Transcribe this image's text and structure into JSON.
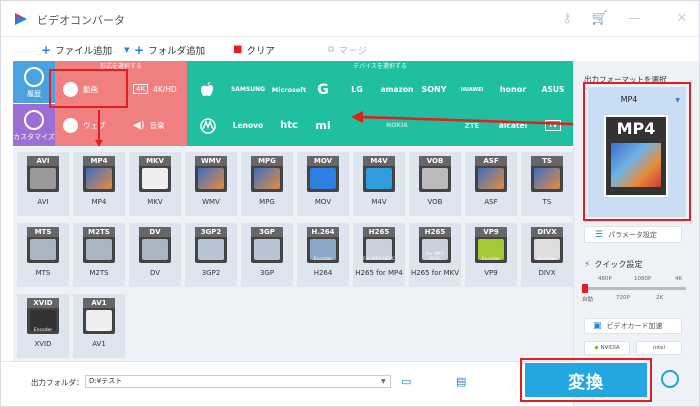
{
  "app": {
    "title": "ビデオコンバータ"
  },
  "toolbar": {
    "add_file": "ファイル追加",
    "add_folder": "フォルダ追加",
    "clear": "クリア",
    "merge": "マージ"
  },
  "categories": {
    "history": "履歴",
    "customize": "カスタマイズ",
    "format_section_title": "形式を選択する",
    "device_section_title": "デバイスを選択する",
    "video": "動画",
    "hd_4k": "4K/HD",
    "web": "ウェブ",
    "music": "音楽"
  },
  "devices": {
    "row1": [
      "",
      "SAMSUNG",
      "Microsoft",
      "G",
      "LG",
      "amazon",
      "SONY",
      "HUAWEI",
      "honor",
      "ASUS"
    ],
    "row2": [
      "",
      "Lenovo",
      "htc",
      "mi",
      "",
      "NOKIA",
      "ZTE",
      "alcatel",
      "TV"
    ]
  },
  "formats": [
    {
      "label": "AVI",
      "caption": "AVI"
    },
    {
      "label": "MP4",
      "caption": "MP4"
    },
    {
      "label": "MKV",
      "caption": "MKV",
      "sub": "matroska"
    },
    {
      "label": "WMV",
      "caption": "WMV"
    },
    {
      "label": "MPG",
      "caption": "MPG"
    },
    {
      "label": "MOV",
      "caption": "MOV"
    },
    {
      "label": "M4V",
      "caption": "M4V"
    },
    {
      "label": "VOB",
      "caption": "VOB"
    },
    {
      "label": "ASF",
      "caption": "ASF"
    },
    {
      "label": "TS",
      "caption": "TS"
    },
    {
      "label": "MTS",
      "caption": "MTS"
    },
    {
      "label": "M2TS",
      "caption": "M2TS"
    },
    {
      "label": "DV",
      "caption": "DV"
    },
    {
      "label": "3GP2",
      "caption": "3GP2"
    },
    {
      "label": "3GP",
      "caption": "3GP"
    },
    {
      "label": "H.264",
      "caption": "H264",
      "sub": "Encoder"
    },
    {
      "label": "H265",
      "caption": "H265 for MP4",
      "sub": "For MP4 HEVC"
    },
    {
      "label": "H265",
      "caption": "H265 for MKV",
      "sub": "For MKV HEVC"
    },
    {
      "label": "VP9",
      "caption": "VP9",
      "sub": "Encoder"
    },
    {
      "label": "DIVX",
      "caption": "DIVX",
      "sub": "Encoder"
    },
    {
      "label": "XVID",
      "caption": "XVID",
      "sub": "Encoder"
    },
    {
      "label": "AV1",
      "caption": "AV1",
      "sub": "Encoder"
    }
  ],
  "right_panel": {
    "title": "出力フォーマットを選択",
    "selected_format": "MP4",
    "params_button": "パラメータ設定",
    "quick_settings": "クイック設定",
    "scale_top": [
      "480P",
      "1080P",
      "4K"
    ],
    "scale_bottom": [
      "自動",
      "720P",
      "2K"
    ],
    "gpu_accel": "ビデオカード加速",
    "nvidia": "NVIDIA",
    "intel": "intel"
  },
  "bottom": {
    "output_folder_label": "出力フォルダ：",
    "output_folder_value": "D:¥テスト"
  },
  "convert_label": "変換",
  "colors": {
    "accent_red": "#e02020",
    "video_pink": "#f08080",
    "device_teal": "#1fbf9f",
    "convert_blue": "#22a7e0",
    "history_blue": "#4aa3df",
    "customize_purple": "#9b6fd6"
  }
}
